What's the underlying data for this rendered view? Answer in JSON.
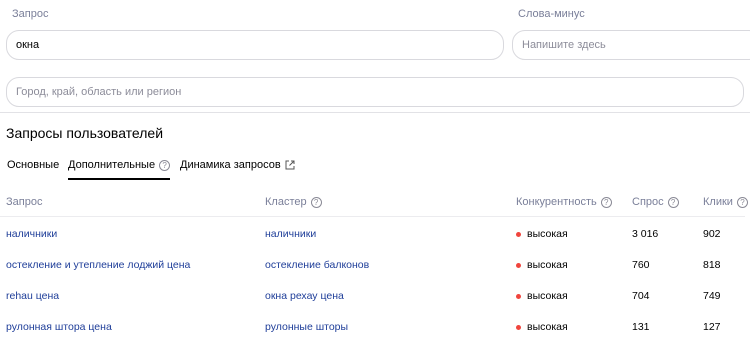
{
  "query": {
    "label": "Запрос",
    "value": "окна"
  },
  "minus_words": {
    "label": "Слова-минус",
    "placeholder": "Напишите здесь"
  },
  "region": {
    "placeholder": "Город, край, область или регион"
  },
  "section_title": "Запросы пользователей",
  "tabs": [
    {
      "label": "Основные",
      "active": false
    },
    {
      "label": "Дополнительные",
      "active": true
    },
    {
      "label": "Динамика запросов",
      "active": false
    }
  ],
  "table": {
    "headers": {
      "query": "Запрос",
      "cluster": "Кластер",
      "competition": "Конкурентность",
      "demand": "Спрос",
      "clicks": "Клики"
    },
    "rows": [
      {
        "query": "наличники",
        "cluster": "наличники",
        "competition": "высокая",
        "demand": "3 016",
        "clicks": "902"
      },
      {
        "query": "остекление и утепление лоджий цена",
        "cluster": "остекление балконов",
        "competition": "высокая",
        "demand": "760",
        "clicks": "818"
      },
      {
        "query": "rehau цена",
        "cluster": "окна рехау цена",
        "competition": "высокая",
        "demand": "704",
        "clicks": "749"
      },
      {
        "query": "рулонная штора цена",
        "cluster": "рулонные шторы",
        "competition": "высокая",
        "demand": "131",
        "clicks": "127"
      }
    ]
  },
  "colors": {
    "link": "#1f3e99",
    "high_competition_dot": "#f0453d",
    "muted_label": "#7a7f99"
  },
  "icons": {
    "help": "question-circle-icon",
    "external": "external-link-icon"
  }
}
